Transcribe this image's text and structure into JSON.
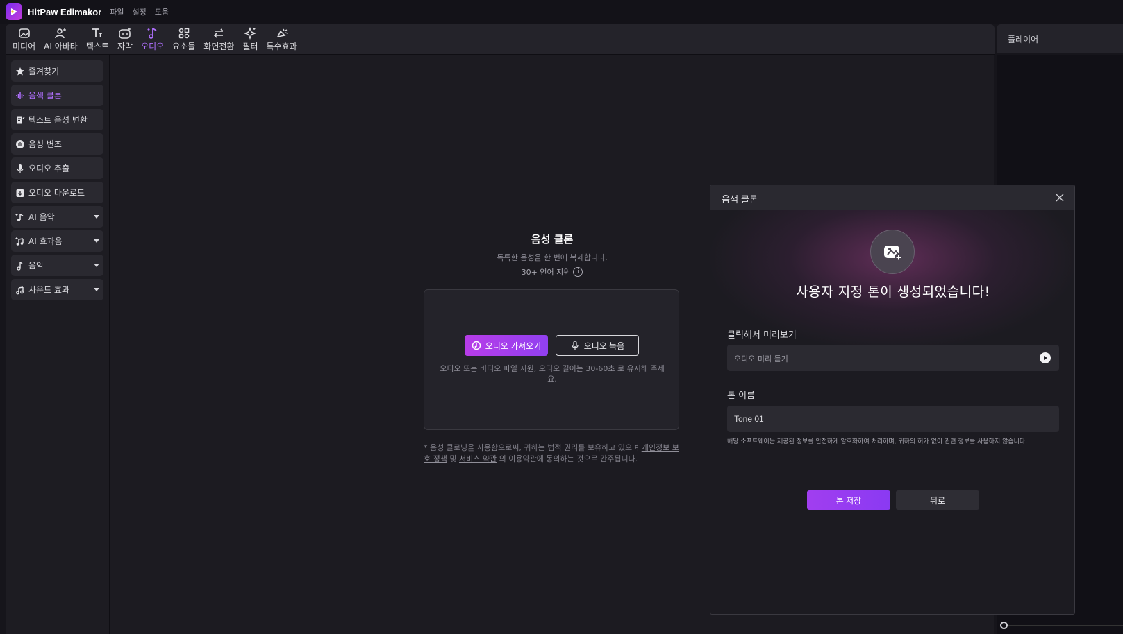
{
  "app": {
    "title": "HitPaw Edimakor",
    "menu": [
      "파일",
      "설정",
      "도움"
    ]
  },
  "toolbar": {
    "tabs": [
      {
        "label": "미디어",
        "icon": "media-icon"
      },
      {
        "label": "AI 아바타",
        "icon": "avatar-icon"
      },
      {
        "label": "텍스트",
        "icon": "text-icon"
      },
      {
        "label": "자막",
        "icon": "subtitle-icon"
      },
      {
        "label": "오디오",
        "icon": "audio-icon",
        "active": true
      },
      {
        "label": "요소들",
        "icon": "elements-icon"
      },
      {
        "label": "화면전환",
        "icon": "transition-icon"
      },
      {
        "label": "필터",
        "icon": "filter-icon"
      },
      {
        "label": "특수효과",
        "icon": "effects-icon"
      }
    ]
  },
  "player": {
    "title": "플레이어"
  },
  "sidebar": {
    "items": [
      {
        "label": "즐겨찾기",
        "icon": "star-icon"
      },
      {
        "label": "음색 클론",
        "icon": "waveform-icon",
        "active": true
      },
      {
        "label": "텍스트 음성 변환",
        "icon": "text-to-speech-icon"
      },
      {
        "label": "음성 변조",
        "icon": "voice-changer-icon"
      },
      {
        "label": "오디오 추출",
        "icon": "microphone-icon"
      },
      {
        "label": "오디오 다운로드",
        "icon": "download-icon"
      },
      {
        "label": "AI 음악",
        "icon": "ai-music-icon",
        "expandable": true
      },
      {
        "label": "AI 효과음",
        "icon": "ai-sfx-icon",
        "expandable": true
      },
      {
        "label": "음악",
        "icon": "music-note-icon",
        "expandable": true
      },
      {
        "label": "사운드 효과",
        "icon": "sound-effect-icon",
        "expandable": true
      }
    ]
  },
  "voice_clone": {
    "title": "음성 클론",
    "subtitle": "독특한 음성을 한 번에 복제합니다.",
    "languages": "30+ 언어 지원",
    "import_button": "오디오 가져오기",
    "record_button": "오디오 녹음",
    "hint": "오디오 또는 비디오 파일 지원, 오디오 길이는 30-60초 로 유지해 주세요.",
    "legal_prefix": "* 음성 클로닝을 사용함으로써, 귀하는 법적 권리를 보유하고 있으며",
    "privacy_link": "개인정보 보호 정책",
    "and": "및",
    "terms_link": "서비스 약관",
    "legal_suffix": "의 이용약관에 동의하는 것으로 간주됩니다."
  },
  "dialog": {
    "title": "음색 클론",
    "success_message": "사용자 지정 톤이 생성되었습니다!",
    "preview_label": "클릭해서 미리보기",
    "preview_placeholder": "오디오 미리 듣기",
    "name_label": "톤 이름",
    "name_value": "Tone 01",
    "disclaimer": "해당 소프트웨어는 제공된 정보를 안전하게 암호화하여 처리하며, 귀하의 허가 없이 관련 정보를 사용하지 않습니다.",
    "save_button": "톤 저장",
    "back_button": "뒤로"
  },
  "colors": {
    "accent": "#a13ef0",
    "active_text": "#b070ff",
    "background": "#1c1b21"
  }
}
